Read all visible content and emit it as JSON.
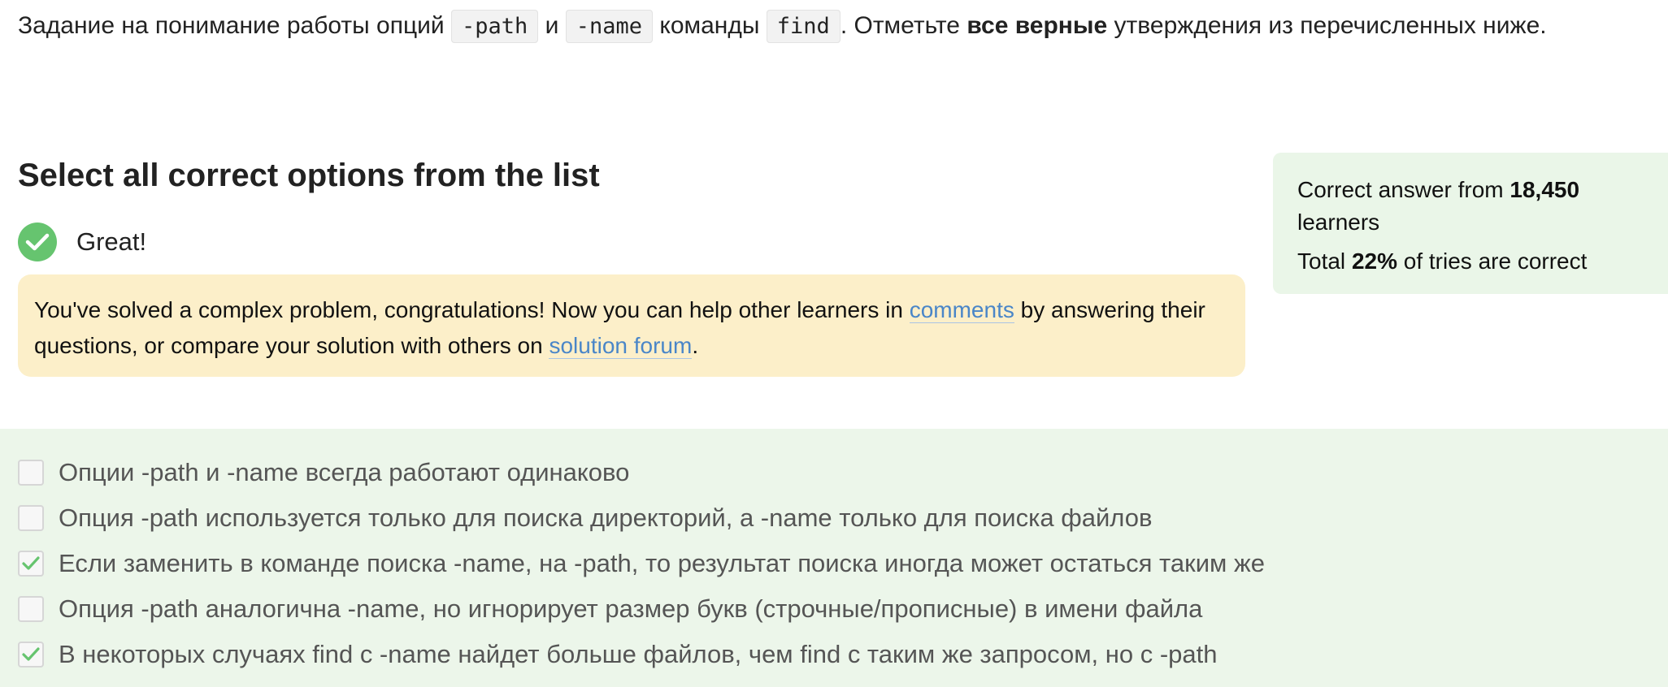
{
  "task": {
    "text_1": "Задание на понимание работы опций ",
    "code_1": "-path",
    "text_2": " и ",
    "code_2": "-name",
    "text_3": " команды ",
    "code_3": "find",
    "text_4": ". Отметьте ",
    "bold": "все верные",
    "text_5": " утверждения из перечисленных ниже."
  },
  "heading": "Select all correct options from the list",
  "result": {
    "label": "Great!",
    "icon": "check-circle-icon"
  },
  "congrats": {
    "text_1": "You've solved a complex problem, congratulations! Now you can help other learners in ",
    "link_comments": "comments",
    "text_2": " by answering their questions, or compare your solution with others on ",
    "link_forum": "solution forum",
    "text_3": "."
  },
  "stats": {
    "line1_prefix": "Correct answer from ",
    "learners_count": "18,450",
    "line1_suffix": " learners",
    "line2_prefix": "Total ",
    "percent": "22%",
    "line2_suffix": " of tries are correct"
  },
  "options": [
    {
      "label": "Опции -path и -name всегда работают одинаково",
      "checked": false
    },
    {
      "label": "Опция -path используется только для поиска директорий, а -name только для поиска файлов",
      "checked": false
    },
    {
      "label": "Если заменить в команде поиска -name, на -path, то результат поиска иногда может остаться таким же",
      "checked": true
    },
    {
      "label": "Опция -path аналогична -name, но игнорирует размер букв (строчные/прописные) в имени файла",
      "checked": false
    },
    {
      "label": "В некоторых случаях find с -name найдет больше файлов, чем find с таким же запросом, но с -path",
      "checked": true
    }
  ],
  "colors": {
    "success_green": "#66c46f",
    "congrats_bg": "#fcefc9",
    "stats_bg": "#eaf6e8",
    "options_bg": "#ecf6ea",
    "link": "#4a86c8"
  }
}
